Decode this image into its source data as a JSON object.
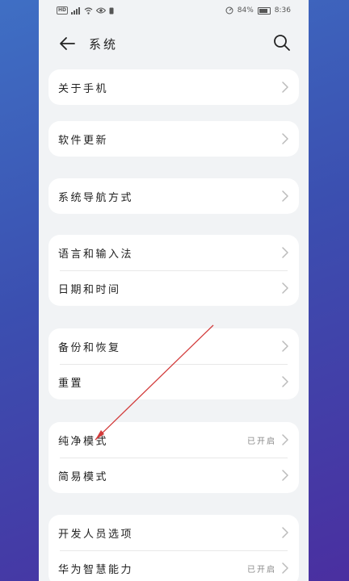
{
  "status_bar": {
    "left_icons": [
      "hd-icon",
      "signal-icon",
      "wifi-icon",
      "eye-icon",
      "notification-icon"
    ],
    "hd": "HD",
    "battery_percent": "84%",
    "time": "8:36"
  },
  "header": {
    "title": "系统"
  },
  "groups": [
    {
      "items": [
        {
          "label": "关于手机"
        }
      ]
    },
    {
      "items": [
        {
          "label": "软件更新"
        }
      ]
    },
    {
      "items": [
        {
          "label": "系统导航方式"
        }
      ]
    },
    {
      "items": [
        {
          "label": "语言和输入法"
        },
        {
          "label": "日期和时间"
        }
      ]
    },
    {
      "items": [
        {
          "label": "备份和恢复"
        },
        {
          "label": "重置"
        }
      ]
    },
    {
      "items": [
        {
          "label": "纯净模式",
          "value": "已开启"
        },
        {
          "label": "简易模式"
        }
      ]
    },
    {
      "items": [
        {
          "label": "开发人员选项"
        },
        {
          "label": "华为智慧能力",
          "value": "已开启"
        }
      ]
    }
  ],
  "colors": {
    "annotation_line": "#d23b3b",
    "card": "#ffffff",
    "page_bg": "#f1f3f5"
  }
}
